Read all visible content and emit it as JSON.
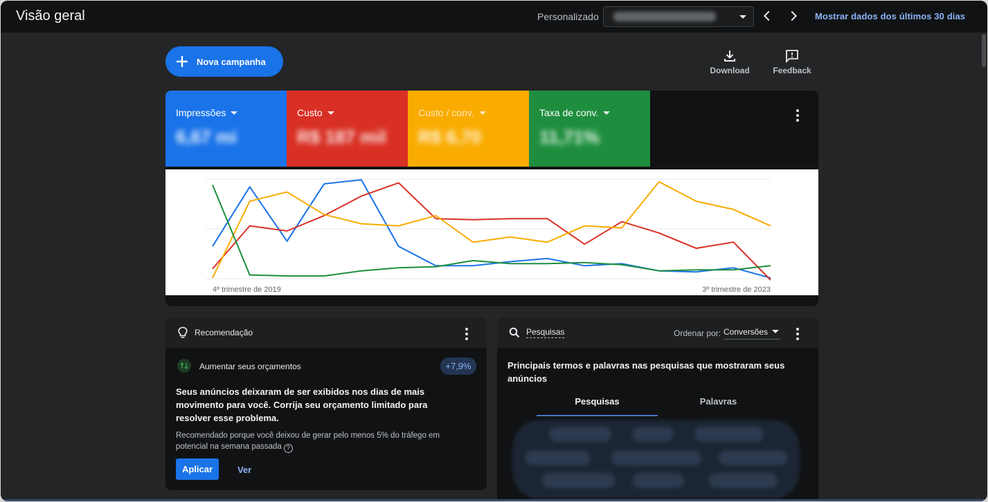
{
  "header": {
    "title": "Visão geral",
    "custom_label": "Personalizado",
    "date_range_text": "",
    "last30_label": "Mostrar dados dos últimos 30 dias"
  },
  "actions": {
    "new_campaign": "Nova campanha",
    "download": "Download",
    "feedback": "Feedback"
  },
  "metrics": [
    {
      "label": "Impressões",
      "value": "6,67 mi",
      "color": "#1a73e8",
      "value_blurred": true
    },
    {
      "label": "Custo",
      "value": "R$ 187 mil",
      "color": "#d93025",
      "value_blurred": true
    },
    {
      "label": "Custo / conv.",
      "value": "R$ 6,70",
      "color": "#f9ab00",
      "value_blurred": true
    },
    {
      "label": "Taxa de conv.",
      "value": "11,71%",
      "color": "#1e8e3e",
      "value_blurred": true
    }
  ],
  "chart_data": {
    "type": "line",
    "x_start_label": "4º trimestre de 2019",
    "x_end_label": "3º trimestre de 2023",
    "y_scale": "independent per series (0-1 normalized)",
    "grid": true,
    "series": [
      {
        "name": "Impressões",
        "color": "#1a73e8",
        "values": [
          0.33,
          0.91,
          0.38,
          0.94,
          0.98,
          0.33,
          0.14,
          0.14,
          0.18,
          0.21,
          0.14,
          0.16,
          0.09,
          0.08,
          0.12,
          0.02
        ]
      },
      {
        "name": "Custo",
        "color": "#d93025",
        "values": [
          0.11,
          0.53,
          0.48,
          0.63,
          0.82,
          0.95,
          0.6,
          0.59,
          0.6,
          0.6,
          0.35,
          0.57,
          0.46,
          0.31,
          0.37,
          0.0
        ]
      },
      {
        "name": "Custo / conv.",
        "color": "#f9ab00",
        "values": [
          0.02,
          0.77,
          0.86,
          0.64,
          0.55,
          0.53,
          0.63,
          0.37,
          0.42,
          0.37,
          0.53,
          0.51,
          0.96,
          0.77,
          0.69,
          0.53
        ]
      },
      {
        "name": "Taxa de conv.",
        "color": "#1e8e3e",
        "values": [
          0.93,
          0.05,
          0.04,
          0.04,
          0.09,
          0.12,
          0.13,
          0.19,
          0.16,
          0.16,
          0.17,
          0.15,
          0.09,
          0.1,
          0.1,
          0.14
        ]
      }
    ]
  },
  "recommendation": {
    "title": "Recomendação",
    "item_label": "Aumentar seus orçamentos",
    "badge": "+7,9%",
    "headline": "Seus anúncios deixaram de ser exibidos nos dias de mais movimento para você. Corrija seu orçamento limitado para resolver esse problema.",
    "reason": "Recomendado porque você deixou de gerar pelo menos 5% do tráfego em potencial na semana passada",
    "apply": "Aplicar",
    "see": "Ver"
  },
  "searches": {
    "title": "Pesquisas",
    "sort_label": "Ordenar por:",
    "sort_value": "Conversões",
    "description": "Principais termos e palavras nas pesquisas que mostraram seus anúncios",
    "tabs": [
      {
        "label": "Pesquisas",
        "active": true
      },
      {
        "label": "Palavras",
        "active": false
      }
    ],
    "cloud_blurred": true
  }
}
